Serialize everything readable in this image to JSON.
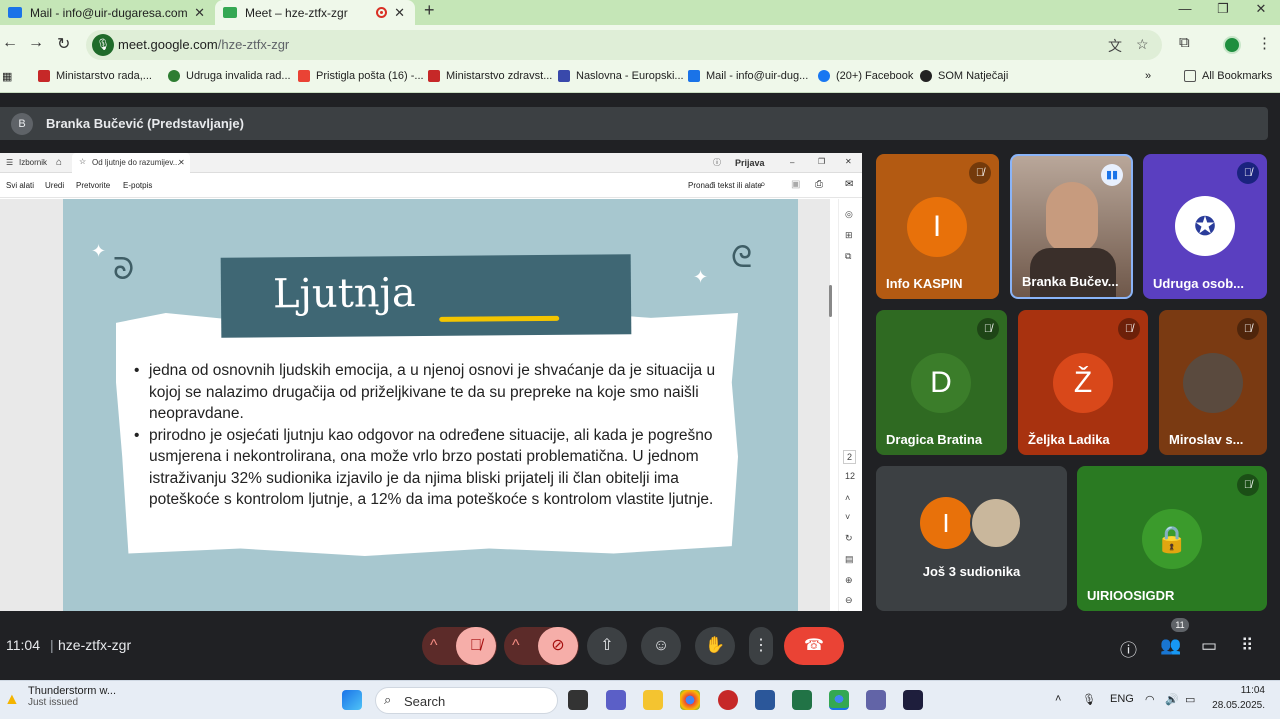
{
  "browser": {
    "tabs": [
      {
        "label": "Mail - info@uir-dugaresa.com",
        "color": "#1a73e8"
      },
      {
        "label": "Meet – hze-ztfx-zgr",
        "color": "#34a853"
      }
    ],
    "url_host": "meet.google.com",
    "url_path": "/hze-ztfx-zgr",
    "bookmarks": [
      "Ministarstvo rada,...",
      "Udruga invalida rad...",
      "Pristigla pošta (16) -...",
      "Ministarstvo zdravst...",
      "Naslovna - Europski...",
      "Mail - info@uir-dug...",
      "(20+) Facebook",
      "SOM Natječaji"
    ],
    "all_bookmarks": "All Bookmarks"
  },
  "meet": {
    "presenter_initial": "B",
    "presenter_label": "Branka Bučević (Predstavljanje)",
    "time": "11:04",
    "meeting_code": "hze-ztfx-zgr",
    "participant_count": "11"
  },
  "pdf": {
    "menu": "Izbornik",
    "doc_tab": "Od ljutnje do razumijev...",
    "signin": "Prijava",
    "tools": [
      "Svi alati",
      "Uredi",
      "Pretvorite",
      "E-potpis"
    ],
    "find": "Pronađi tekst ili alate",
    "page_current": "2",
    "page_total": "12"
  },
  "slide": {
    "title": "Ljutnja",
    "bullets": [
      "jedna od osnovnih ljudskih emocija, a u njenoj osnovi je shvaćanje da je situacija u kojoj se nalazimo drugačija od priželjkivane te da su prepreke na koje smo naišli neopravdane.",
      "prirodno je osjećati ljutnju kao odgovor na određene situacije, ali kada je pogrešno usmjerena i nekontrolirana, ona može vrlo brzo postati problematična. U jednom istraživanju 32% sudionika izjavilo je da njima bliski prijatelj ili član obitelji ima poteškoće s kontrolom ljutnje, a 12% da ima poteškoće s kontrolom vlastite ljutnje."
    ]
  },
  "participants": [
    {
      "name": "Info KASPIN",
      "initial": "I",
      "bg": "#b35a12",
      "circle": "#e8710a"
    },
    {
      "name": "Branka Bučev...",
      "initial": "",
      "bg": "#8a6d5a",
      "circle": ""
    },
    {
      "name": "Udruga osob...",
      "initial": "",
      "bg": "#5a3fc0",
      "circle": "#ffffff"
    },
    {
      "name": "Dragica Bratina",
      "initial": "D",
      "bg": "#2f6a22",
      "circle": "#3b7d2a"
    },
    {
      "name": "Željka Ladika",
      "initial": "Ž",
      "bg": "#a8320f",
      "circle": "#d9481a"
    },
    {
      "name": "Miroslav s...",
      "initial": "",
      "bg": "#7a3a12",
      "circle": "#555"
    },
    {
      "name": "Još 3 sudionika",
      "initial": "I",
      "bg": "#3c4043",
      "circle": "#e8710a"
    },
    {
      "name": "UIRIOOSIGDR",
      "initial": "",
      "bg": "#2a7a22",
      "circle": "#3b9b2c"
    }
  ],
  "taskbar": {
    "weather_title": "Thunderstorm w...",
    "weather_sub": "Just issued",
    "search": "Search",
    "lang": "ENG",
    "time": "11:04",
    "date": "28.05.2025."
  }
}
